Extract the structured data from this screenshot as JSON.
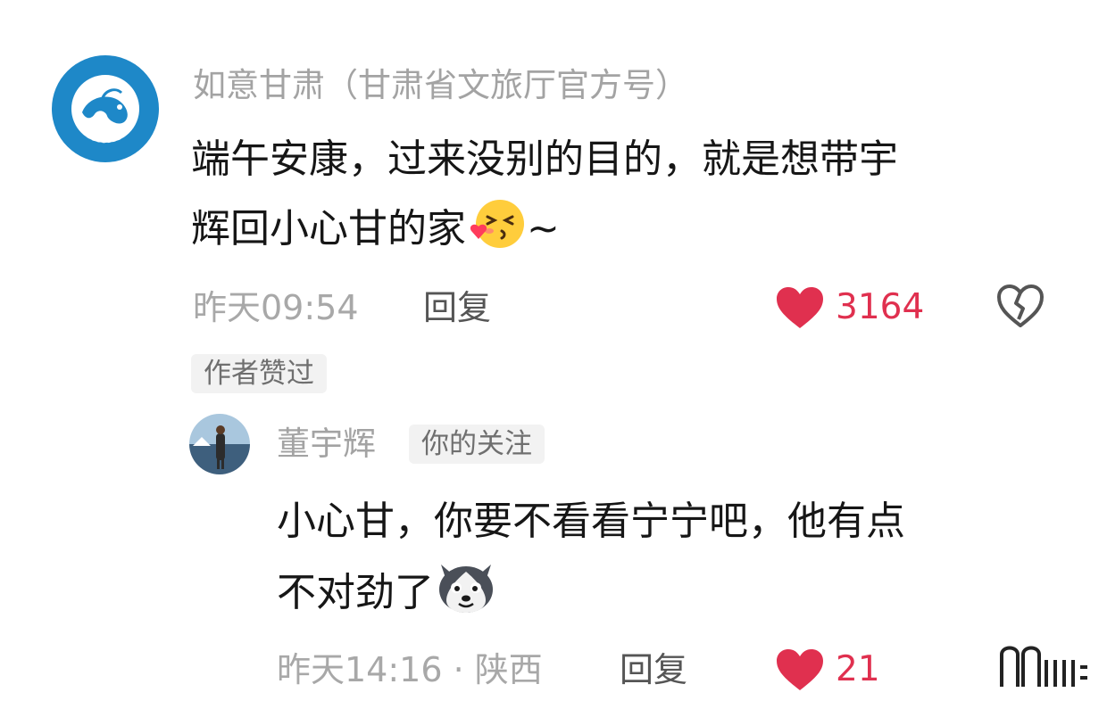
{
  "comments": [
    {
      "username": "如意甘肃（甘肃省文旅厅官方号）",
      "avatar_icon": "gansu-culture-tourism-logo",
      "text_line1": "端午安康，过来没别的目的，就是想带宇",
      "text_line2": "辉回小心甘的家",
      "emoji": "kiss-heart-emoji",
      "text_suffix": "~",
      "time": "昨天09:54",
      "reply_label": "回复",
      "likes": "3164",
      "badge": "作者赞过"
    },
    {
      "username": "董宇辉",
      "follow_badge": "你的关注",
      "avatar_icon": "user-photo-avatar",
      "text_line1": "小心甘，你要不看看宁宁吧，他有点",
      "text_line2": "不对劲了",
      "emoji": "husky-dog-emoji",
      "time": "昨天14:16 · 陕西",
      "reply_label": "回复",
      "likes": "21"
    }
  ],
  "colors": {
    "like_red": "#e0304f",
    "meta_gray": "#a8a8a8",
    "username_gray": "#a3a3a3",
    "text_dark": "#161616",
    "logo_blue": "#1e88c8"
  }
}
